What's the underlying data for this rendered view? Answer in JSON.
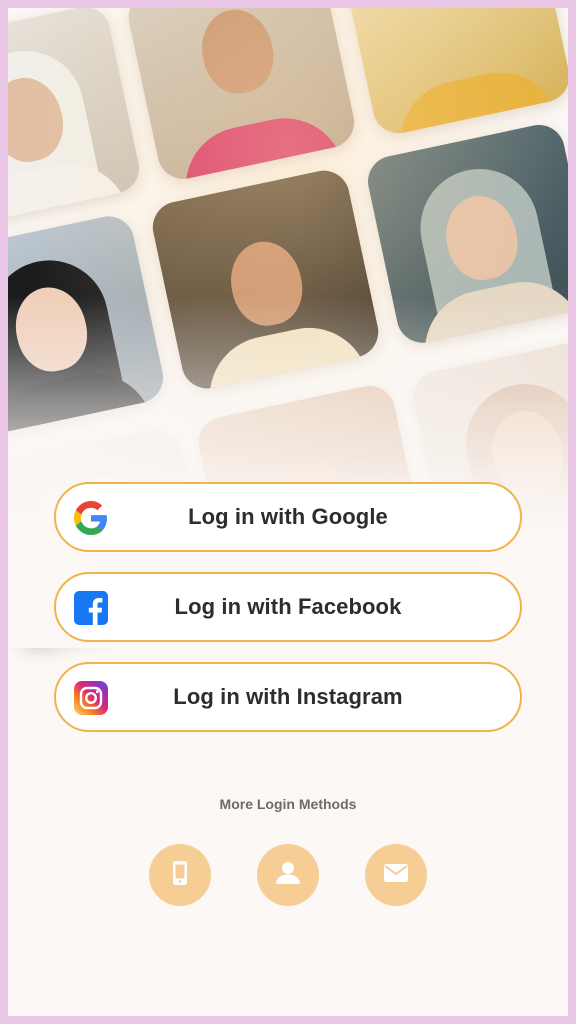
{
  "login_buttons": [
    {
      "label": "Log in with Google",
      "icon": "google-icon"
    },
    {
      "label": "Log in with Facebook",
      "icon": "facebook-icon"
    },
    {
      "label": "Log in with Instagram",
      "icon": "instagram-icon"
    }
  ],
  "more_methods": {
    "label": "More Login Methods",
    "options": [
      {
        "icon": "phone-icon"
      },
      {
        "icon": "user-icon"
      },
      {
        "icon": "mail-icon"
      }
    ]
  },
  "colors": {
    "accent_border": "#f2b24d",
    "method_circle": "#f6cd95",
    "frame_border": "#e9c6e6",
    "background": "#fbf8f5"
  }
}
